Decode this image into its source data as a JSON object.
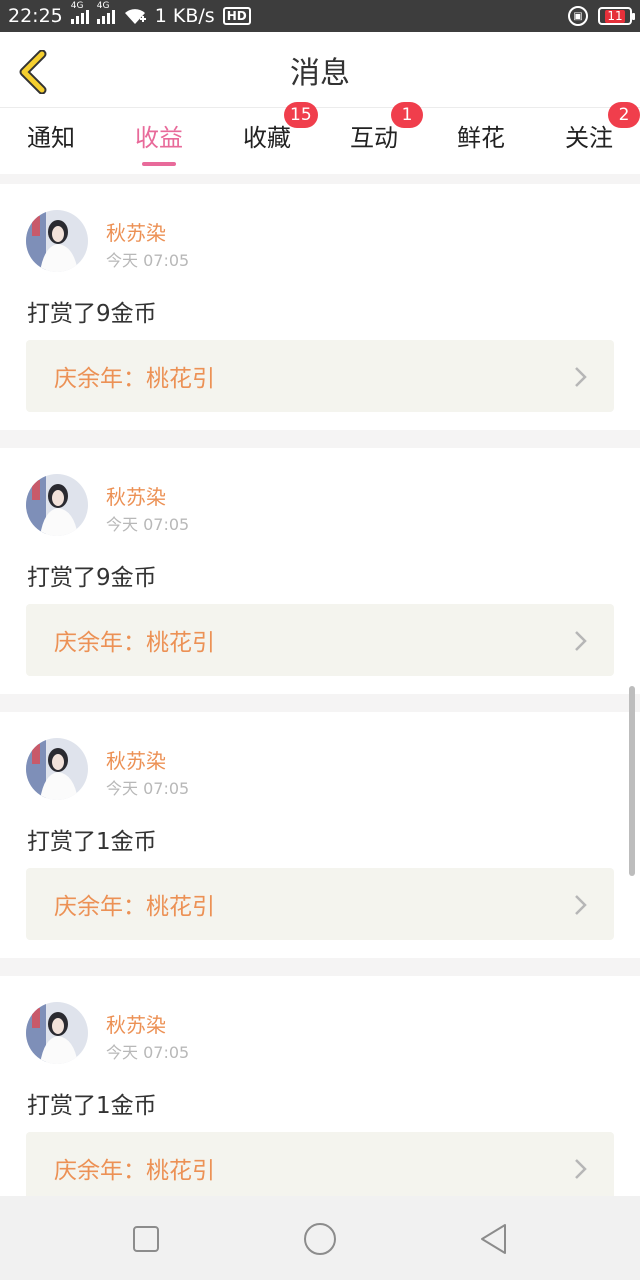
{
  "status_bar": {
    "time": "22:25",
    "network_label": "4G",
    "speed": "1 KB/s",
    "hd_label": "HD",
    "battery_level": "11",
    "icons": [
      "signal-4g-icon",
      "signal-4g-icon",
      "wifi-icon",
      "hd-icon",
      "rotation-lock-icon",
      "battery-icon"
    ]
  },
  "header": {
    "title": "消息",
    "back_icon": "chevron-left-icon"
  },
  "tabs": [
    {
      "label": "通知",
      "badge": "",
      "active": false
    },
    {
      "label": "收益",
      "badge": "",
      "active": true
    },
    {
      "label": "收藏",
      "badge": "15",
      "active": false
    },
    {
      "label": "互动",
      "badge": "1",
      "active": false
    },
    {
      "label": "鲜花",
      "badge": "",
      "active": false
    },
    {
      "label": "关注",
      "badge": "2",
      "active": false
    }
  ],
  "messages": [
    {
      "user": "秋苏染",
      "time": "今天 07:05",
      "text": "打赏了9金币",
      "book": "庆余年：桃花引"
    },
    {
      "user": "秋苏染",
      "time": "今天 07:05",
      "text": "打赏了9金币",
      "book": "庆余年：桃花引"
    },
    {
      "user": "秋苏染",
      "time": "今天 07:05",
      "text": "打赏了1金币",
      "book": "庆余年：桃花引"
    },
    {
      "user": "秋苏染",
      "time": "今天 07:05",
      "text": "打赏了1金币",
      "book": "庆余年：桃花引"
    }
  ],
  "nav_bar": {
    "icons": [
      "square-recents-icon",
      "circle-home-icon",
      "triangle-back-icon"
    ]
  },
  "colors": {
    "accent_pink": "#e86a9a",
    "accent_orange": "#ec9155",
    "badge_red": "#f03e4c",
    "back_yellow": "#f5cf2f"
  }
}
